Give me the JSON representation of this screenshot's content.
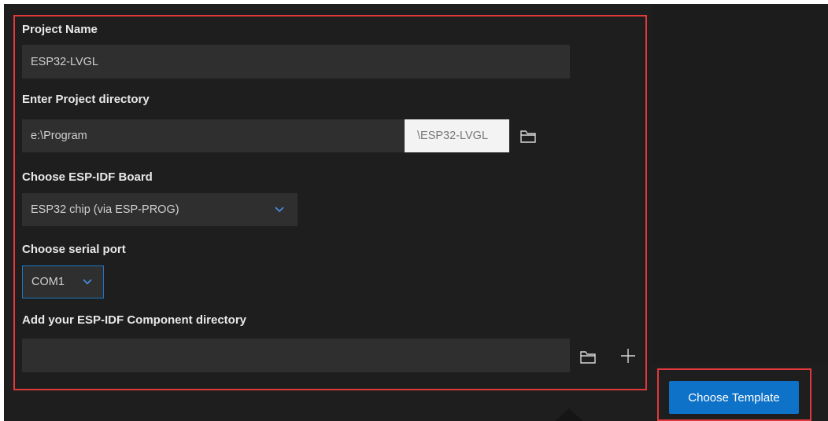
{
  "form": {
    "project_name_label": "Project Name",
    "project_name_value": "ESP32-LVGL",
    "project_dir_label": "Enter Project directory",
    "project_dir_value": "e:\\Program",
    "project_dir_suffix": "\\ESP32-LVGL",
    "board_label": "Choose ESP-IDF Board",
    "board_value": "ESP32 chip (via ESP-PROG)",
    "serial_port_label": "Choose serial port",
    "serial_port_value": "COM1",
    "component_dir_label": "Add your ESP-IDF Component directory",
    "component_dir_value": ""
  },
  "actions": {
    "choose_template_label": "Choose Template"
  },
  "icons": {
    "browse": "folder-icon",
    "add": "plus-icon",
    "dropdown": "chevron-down-icon"
  },
  "colors": {
    "background": "#1e1e1e",
    "input_bg": "#2f2f2f",
    "accent": "#0e72c8",
    "highlight": "#e0393b",
    "chevron": "#4a8fe0"
  }
}
